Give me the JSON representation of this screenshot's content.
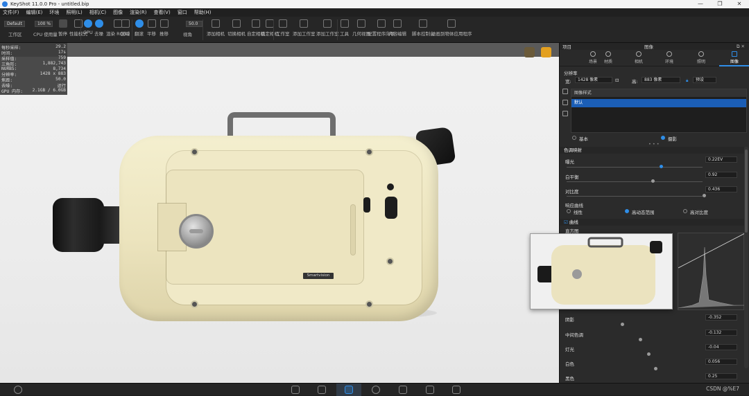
{
  "window": {
    "title": "KeyShot 11.0.0 Pro  - untitled.bip",
    "controls": [
      "—",
      "❐",
      "✕"
    ]
  },
  "menu": [
    "文件(F)",
    "编辑(E)",
    "环境",
    "照明(L)",
    "相机(C)",
    "图像",
    "渲染(R)",
    "查看(V)",
    "窗口",
    "帮助(H)"
  ],
  "toolbar": {
    "workspace_select": "Default",
    "cpu_select": "100 %",
    "zoom_field": "50.0",
    "items": [
      {
        "label": "工作区",
        "icon": "workspace-icon"
      },
      {
        "label": "CPU 使用量",
        "icon": "cpu-icon"
      },
      {
        "label": "暂停",
        "icon": "pause-icon"
      },
      {
        "label": "性能模式",
        "icon": "performance-icon"
      },
      {
        "label": "GPU",
        "icon": "gpu-icon"
      },
      {
        "label": "去噪",
        "icon": "denoise-icon"
      },
      {
        "label": "渲染 RGBD",
        "icon": "rgbd-icon"
      },
      {
        "label": "区域",
        "icon": "region-icon"
      },
      {
        "label": "翻滚",
        "icon": "tumble-icon"
      },
      {
        "label": "平移",
        "icon": "pan-icon"
      },
      {
        "label": "推移",
        "icon": "dolly-icon"
      },
      {
        "label": "视角",
        "icon": "fov-icon"
      },
      {
        "label": "添加相机",
        "icon": "add-camera-icon"
      },
      {
        "label": "切换相机",
        "icon": "switch-camera-icon"
      },
      {
        "label": "自定相机",
        "icon": "custom-camera-icon"
      },
      {
        "label": "锁定相机",
        "icon": "lock-camera-icon"
      },
      {
        "label": "工作室",
        "icon": "studio-icon"
      },
      {
        "label": "添加工作室",
        "icon": "add-studio-icon"
      },
      {
        "label": "添加工作室",
        "icon": "add-studio-2-icon"
      },
      {
        "label": "工具",
        "icon": "tools-icon"
      },
      {
        "label": "几何视图",
        "icon": "geometry-view-icon"
      },
      {
        "label": "配置程序向导",
        "icon": "configurator-icon"
      },
      {
        "label": "内容编辑",
        "icon": "content-edit-icon"
      },
      {
        "label": "脚本控制台",
        "icon": "script-console-icon"
      },
      {
        "label": "动画到物体应用程序",
        "icon": "animation-app-icon"
      }
    ]
  },
  "stats": [
    {
      "k": "每秒采样:",
      "v": "29.2"
    },
    {
      "k": "时间:",
      "v": "17s"
    },
    {
      "k": "采样值:",
      "v": "759"
    },
    {
      "k": "三角形:",
      "v": "1,882,743"
    },
    {
      "k": "NURBS:",
      "v": "8,734"
    },
    {
      "k": "分辨率:",
      "v": "1428 x 883"
    },
    {
      "k": "焦距:",
      "v": "50.0"
    },
    {
      "k": "去噪:",
      "v": "运行"
    },
    {
      "k": "GPU 内存:",
      "v": "2.1GB / 6.0GB"
    }
  ],
  "model": {
    "badge": "Smartvision"
  },
  "right_panel": {
    "header_left": "项目",
    "header_mid": "图像",
    "tabs": [
      "场景",
      "材质",
      "相机",
      "环境",
      "照明",
      "图像"
    ],
    "active_tab": "图像",
    "resolution_label": "分辨率",
    "width": "1428 像素",
    "height": "883 像素",
    "height_prefix": "高:",
    "preset": "预设",
    "image_style_header": "图像样式",
    "style_item": "默认",
    "mode_basic": "基本",
    "mode_photo": "摄影",
    "section_tone": "色调映射",
    "exposure_label": "曝光",
    "exposure_value": "0.22EV",
    "white_balance_label": "白平衡",
    "white_balance_value": "0.92",
    "contrast_label": "对比度",
    "contrast_value": "0.436",
    "response_label": "响应曲线",
    "curve_linear": "线性",
    "curve_high": "高动态范围",
    "curve_adaptive": "高对比度",
    "section_curve": "曲线",
    "histogram_label": "直方图",
    "shadows_label": "阴影",
    "shadows_value": "-0.352",
    "midtones_label": "中间色调",
    "midtones_value": "-0.132",
    "highlights_label": "灯光",
    "highlights_value": "-0.04",
    "whites_label": "白色",
    "whites_value": "0.056",
    "blacks_label": "黑色",
    "blacks_value": "0.25"
  },
  "bottom": {
    "watermark": "CSDN @%E7",
    "icons": [
      "import-icon",
      "library-icon",
      "project-icon",
      "animation-icon",
      "keyshotxr-icon",
      "render-icon",
      "screenshot-icon"
    ]
  },
  "colors": {
    "accent": "#2f8ee8",
    "selection": "#1b5eb6",
    "model_body": "#efe7c3"
  }
}
